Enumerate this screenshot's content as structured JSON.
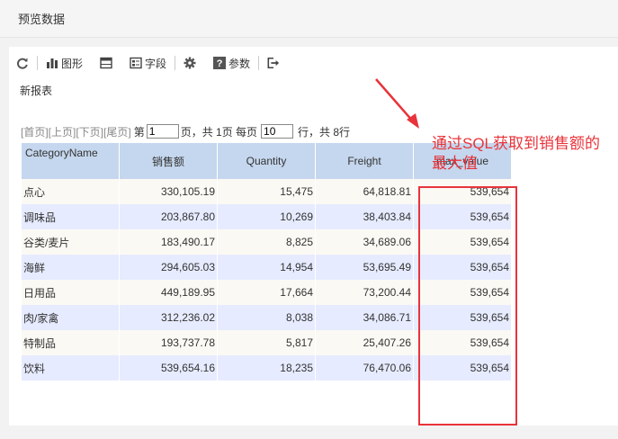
{
  "window": {
    "title": "预览数据"
  },
  "toolbar": {
    "refresh_icon": "refresh-icon",
    "chart_label": "图形",
    "fields_label": "字段",
    "params_label": "参数"
  },
  "report": {
    "name": "新报表"
  },
  "pager": {
    "first": "[首页]",
    "prev": "[上页]",
    "next": "[下页]",
    "last": "[尾页]",
    "page_prefix": "第",
    "page_value": "1",
    "page_suffix": "页，共 1页 每页",
    "per_page_value": "10",
    "rows_suffix": "行，共 8行"
  },
  "table": {
    "headers": [
      "CategoryName",
      "销售额",
      "Quantity",
      "Freight",
      "max_value"
    ],
    "rows": [
      [
        "点心",
        "330,105.19",
        "15,475",
        "64,818.81",
        "539,654"
      ],
      [
        "调味品",
        "203,867.80",
        "10,269",
        "38,403.84",
        "539,654"
      ],
      [
        "谷类/麦片",
        "183,490.17",
        "8,825",
        "34,689.06",
        "539,654"
      ],
      [
        "海鲜",
        "294,605.03",
        "14,954",
        "53,695.49",
        "539,654"
      ],
      [
        "日用品",
        "449,189.95",
        "17,664",
        "73,200.44",
        "539,654"
      ],
      [
        "肉/家禽",
        "312,236.02",
        "8,038",
        "34,086.71",
        "539,654"
      ],
      [
        "特制品",
        "193,737.78",
        "5,817",
        "25,407.26",
        "539,654"
      ],
      [
        "饮料",
        "539,654.16",
        "18,235",
        "76,470.06",
        "539,654"
      ]
    ]
  },
  "annotation": {
    "line1": "通过SQL获取到销售额的",
    "line2": "最大值",
    "color": "#e8333a"
  }
}
